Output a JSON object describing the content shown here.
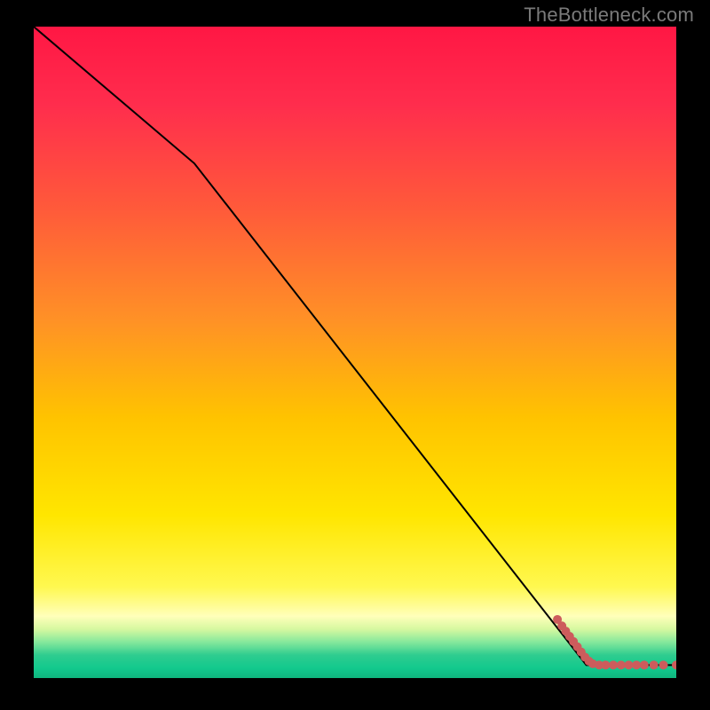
{
  "attribution": "TheBottleneck.com",
  "chart_data": {
    "type": "line",
    "title": "",
    "xlabel": "",
    "ylabel": "",
    "xlim": [
      0,
      100
    ],
    "ylim": [
      0,
      100
    ],
    "grid": false,
    "curve": [
      {
        "x": 0,
        "y": 100
      },
      {
        "x": 25,
        "y": 79
      },
      {
        "x": 86,
        "y": 2
      },
      {
        "x": 100,
        "y": 2
      }
    ],
    "curve_color": "#000000",
    "scatter_points": [
      {
        "x": 81.5,
        "y": 9.0
      },
      {
        "x": 82.2,
        "y": 8.0
      },
      {
        "x": 82.8,
        "y": 7.2
      },
      {
        "x": 83.4,
        "y": 6.4
      },
      {
        "x": 84.0,
        "y": 5.6
      },
      {
        "x": 84.6,
        "y": 4.8
      },
      {
        "x": 85.2,
        "y": 4.0
      },
      {
        "x": 85.8,
        "y": 3.2
      },
      {
        "x": 86.4,
        "y": 2.6
      },
      {
        "x": 87.0,
        "y": 2.2
      },
      {
        "x": 88.0,
        "y": 2.0
      },
      {
        "x": 89.0,
        "y": 2.0
      },
      {
        "x": 90.2,
        "y": 2.0
      },
      {
        "x": 91.4,
        "y": 2.0
      },
      {
        "x": 92.6,
        "y": 2.0
      },
      {
        "x": 93.8,
        "y": 2.0
      },
      {
        "x": 95.0,
        "y": 2.0
      },
      {
        "x": 96.5,
        "y": 2.0
      },
      {
        "x": 98.0,
        "y": 2.0
      },
      {
        "x": 100.0,
        "y": 2.0
      }
    ],
    "scatter_color": "#cd5c5c",
    "scatter_radius": 5,
    "gradient_fill": {
      "stops": [
        {
          "offset": 0.0,
          "color": "#ff1744"
        },
        {
          "offset": 0.12,
          "color": "#ff2d4d"
        },
        {
          "offset": 0.28,
          "color": "#ff5a3a"
        },
        {
          "offset": 0.45,
          "color": "#ff9126"
        },
        {
          "offset": 0.6,
          "color": "#ffc300"
        },
        {
          "offset": 0.75,
          "color": "#ffe600"
        },
        {
          "offset": 0.86,
          "color": "#fff850"
        },
        {
          "offset": 0.905,
          "color": "#ffffba"
        },
        {
          "offset": 0.925,
          "color": "#d6f8a0"
        },
        {
          "offset": 0.945,
          "color": "#84e89c"
        },
        {
          "offset": 0.965,
          "color": "#2ecc8f"
        },
        {
          "offset": 0.985,
          "color": "#12c98d"
        },
        {
          "offset": 1.0,
          "color": "#0fb57e"
        }
      ]
    }
  }
}
